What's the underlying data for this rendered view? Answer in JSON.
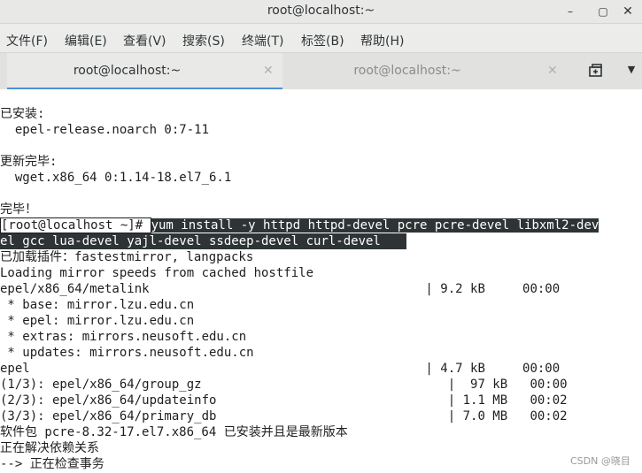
{
  "window": {
    "title": "root@localhost:~",
    "controls": {
      "minimize": "–",
      "maximize": "▢",
      "close": "✕"
    }
  },
  "menu": [
    {
      "label": "文件(F)"
    },
    {
      "label": "编辑(E)"
    },
    {
      "label": "查看(V)"
    },
    {
      "label": "搜索(S)"
    },
    {
      "label": "终端(T)"
    },
    {
      "label": "标签(B)"
    },
    {
      "label": "帮助(H)"
    }
  ],
  "tabs": [
    {
      "label": "root@localhost:~",
      "close": "✕",
      "active": true
    },
    {
      "label": "root@localhost:~",
      "close": "✕",
      "active": false
    }
  ],
  "terminal": {
    "lines": [
      "已安装:",
      "  epel-release.noarch 0:7-11",
      "",
      "更新完毕:",
      "  wget.x86_64 0:1.14-18.el7_6.1",
      "",
      "完毕！",
      "",
      "",
      "已加载插件：fastestmirror, langpacks",
      "Loading mirror speeds from cached hostfile",
      "epel/x86_64/metalink                                     | 9.2 kB     00:00",
      " * base: mirror.lzu.edu.cn",
      " * epel: mirror.lzu.edu.cn",
      " * extras: mirrors.neusoft.edu.cn",
      " * updates: mirrors.neusoft.edu.cn",
      "epel                                                     | 4.7 kB     00:00",
      "(1/3): epel/x86_64/group_gz                                 |  97 kB   00:00",
      "(2/3): epel/x86_64/updateinfo                               | 1.1 MB   00:02",
      "(3/3): epel/x86_64/primary_db                               | 7.0 MB   00:02",
      "软件包 pcre-8.32-17.el7.x86_64 已安装并且是最新版本",
      "正在解决依赖关系",
      "--> 正在检查事务"
    ],
    "prompt": {
      "prefix": "[root@localhost ~]# ",
      "command_line1": "yum install -y httpd httpd-devel pcre pcre-devel libxml2-dev",
      "command_line2": "el gcc lua-devel yajl-devel ssdeep-devel curl-devel"
    }
  },
  "watermark": "CSDN @晓目"
}
